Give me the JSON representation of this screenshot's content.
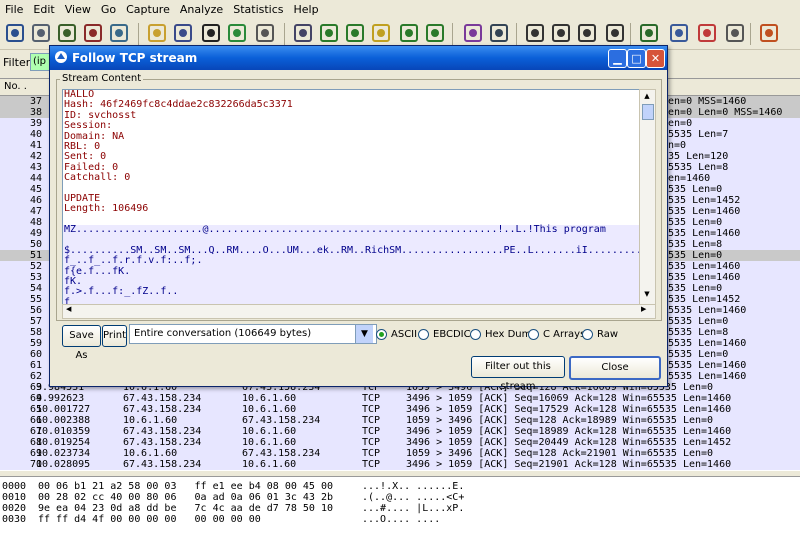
{
  "menu": [
    "File",
    "Edit",
    "View",
    "Go",
    "Capture",
    "Analyze",
    "Statistics",
    "Help"
  ],
  "toolbar_icons": [
    "interface-list-icon",
    "capture-options-icon",
    "start-capture-icon",
    "stop-capture-icon",
    "restart-capture-icon",
    "open-file-icon",
    "save-file-icon",
    "close-file-icon",
    "reload-icon",
    "print-icon",
    "find-packet-icon",
    "go-back-icon",
    "go-forward-icon",
    "go-to-packet-icon",
    "go-first-icon",
    "go-last-icon",
    "colorize-icon",
    "auto-scroll-icon",
    "zoom-in-icon",
    "zoom-out-icon",
    "zoom-normal-icon",
    "resize-columns-icon",
    "capture-filters-icon",
    "display-filters-icon",
    "coloring-rules-icon",
    "preferences-icon",
    "help-icon"
  ],
  "filter": {
    "label": "Filter:",
    "value": "(ip"
  },
  "packet_list": {
    "header": {
      "no": "No. ."
    },
    "rows": [
      {
        "no": "37",
        "time": "",
        "src": "",
        "dst": "",
        "proto": "",
        "info": "Len=0 MSS=1460",
        "sel": true
      },
      {
        "no": "38",
        "time": "",
        "src": "",
        "dst": "",
        "proto": "",
        "info": "Len=0 Len=0 MSS=1460",
        "sel": true
      },
      {
        "no": "39",
        "time": "",
        "src": "",
        "dst": "",
        "proto": "",
        "info": "Len=0"
      },
      {
        "no": "40",
        "time": "",
        "src": "",
        "dst": "",
        "proto": "",
        "info": "65535 Len=7"
      },
      {
        "no": "41",
        "time": "",
        "src": "",
        "dst": "",
        "proto": "",
        "info": "en=0"
      },
      {
        "no": "42",
        "time": "",
        "src": "",
        "dst": "",
        "proto": "",
        "info": "535 Len=120"
      },
      {
        "no": "43",
        "time": "",
        "src": "",
        "dst": "",
        "proto": "",
        "info": "65535 Len=8"
      },
      {
        "no": "44",
        "time": "",
        "src": "",
        "dst": "",
        "proto": "",
        "info": "Len=1460"
      },
      {
        "no": "45",
        "time": "",
        "src": "",
        "dst": "",
        "proto": "",
        "info": "5535 Len=0"
      },
      {
        "no": "46",
        "time": "",
        "src": "",
        "dst": "",
        "proto": "",
        "info": "5535 Len=1452"
      },
      {
        "no": "47",
        "time": "",
        "src": "",
        "dst": "",
        "proto": "",
        "info": "5535 Len=1460"
      },
      {
        "no": "48",
        "time": "",
        "src": "",
        "dst": "",
        "proto": "",
        "info": "5535 Len=0"
      },
      {
        "no": "49",
        "time": "",
        "src": "",
        "dst": "",
        "proto": "",
        "info": "5535 Len=1460"
      },
      {
        "no": "50",
        "time": "",
        "src": "",
        "dst": "",
        "proto": "",
        "info": "5535 Len=8"
      },
      {
        "no": "51",
        "time": "",
        "src": "",
        "dst": "",
        "proto": "",
        "info": "5535 Len=0",
        "sel": true
      },
      {
        "no": "52",
        "time": "",
        "src": "",
        "dst": "",
        "proto": "",
        "info": "5535 Len=1460"
      },
      {
        "no": "53",
        "time": "",
        "src": "",
        "dst": "",
        "proto": "",
        "info": "5535 Len=1460"
      },
      {
        "no": "54",
        "time": "",
        "src": "",
        "dst": "",
        "proto": "",
        "info": "5535 Len=0"
      },
      {
        "no": "55",
        "time": "",
        "src": "",
        "dst": "",
        "proto": "",
        "info": "5535 Len=1452"
      },
      {
        "no": "56",
        "time": "",
        "src": "",
        "dst": "",
        "proto": "",
        "info": "65535 Len=1460"
      },
      {
        "no": "57",
        "time": "",
        "src": "",
        "dst": "",
        "proto": "",
        "info": "65535 Len=0"
      },
      {
        "no": "58",
        "time": "",
        "src": "",
        "dst": "",
        "proto": "",
        "info": "65535 Len=8"
      },
      {
        "no": "59",
        "time": "",
        "src": "",
        "dst": "",
        "proto": "",
        "info": "65535 Len=1460"
      },
      {
        "no": "60",
        "time": "",
        "src": "",
        "dst": "",
        "proto": "",
        "info": "65535 Len=0"
      },
      {
        "no": "61",
        "time": "",
        "src": "",
        "dst": "",
        "proto": "",
        "info": "65535 Len=1460"
      },
      {
        "no": "62",
        "time": "",
        "src": "",
        "dst": "",
        "proto": "",
        "info": "65535 Len=1460"
      },
      {
        "no": "63",
        "time": "9.984531",
        "src": "10.6.1.60",
        "dst": "67.43.158.234",
        "proto": "TCP",
        "info": "1059 > 3496 [ACK] Seq=128 Ack=16069 Win=65535 Len=0"
      },
      {
        "no": "64",
        "time": "9.992623",
        "src": "67.43.158.234",
        "dst": "10.6.1.60",
        "proto": "TCP",
        "info": "3496 > 1059 [ACK] Seq=16069 Ack=128 Win=65535 Len=1460"
      },
      {
        "no": "65",
        "time": "10.001727",
        "src": "67.43.158.234",
        "dst": "10.6.1.60",
        "proto": "TCP",
        "info": "3496 > 1059 [ACK] Seq=17529 Ack=128 Win=65535 Len=1460"
      },
      {
        "no": "66",
        "time": "10.002388",
        "src": "10.6.1.60",
        "dst": "67.43.158.234",
        "proto": "TCP",
        "info": "1059 > 3496 [ACK] Seq=128 Ack=18989 Win=65535 Len=0"
      },
      {
        "no": "67",
        "time": "10.010359",
        "src": "67.43.158.234",
        "dst": "10.6.1.60",
        "proto": "TCP",
        "info": "3496 > 1059 [ACK] Seq=18989 Ack=128 Win=65535 Len=1460"
      },
      {
        "no": "68",
        "time": "10.019254",
        "src": "67.43.158.234",
        "dst": "10.6.1.60",
        "proto": "TCP",
        "info": "3496 > 1059 [ACK] Seq=20449 Ack=128 Win=65535 Len=1452"
      },
      {
        "no": "69",
        "time": "10.023734",
        "src": "10.6.1.60",
        "dst": "67.43.158.234",
        "proto": "TCP",
        "info": "1059 > 3496 [ACK] Seq=128 Ack=21901 Win=65535 Len=0"
      },
      {
        "no": "70",
        "time": "10.028095",
        "src": "67.43.158.234",
        "dst": "10.6.1.60",
        "proto": "TCP",
        "info": "3496 > 1059 [ACK] Seq=21901 Ack=128 Win=65535 Len=1460"
      }
    ]
  },
  "bytes_pane": [
    {
      "offset": "0000",
      "hex": "00 06 b1 21 a2 58 00 03   ff e1 ee b4 08 00 45 00",
      "ascii": "...!.X.. ......E."
    },
    {
      "offset": "0010",
      "hex": "00 28 02 cc 40 00 80 06   0a ad 0a 06 01 3c 43 2b",
      "ascii": ".(..@... .....<C+"
    },
    {
      "offset": "0020",
      "hex": "9e ea 04 23 0d a8 dd be   7c 4c aa de d7 78 50 10",
      "ascii": "...#.... |L...xP."
    },
    {
      "offset": "0030",
      "hex": "ff ff d4 4f 00 00 00 00   00 00 00 00",
      "ascii": "...O.... ...."
    }
  ],
  "dialog": {
    "title": "Follow TCP stream",
    "stream_label": "Stream Content",
    "client_lines": [
      "HALLO",
      "Hash: 46f2469fc8c4ddae2c832266da5c3371",
      "ID: svchosst",
      "Session:",
      "Domain: NA",
      "RBL: 0",
      "Sent: 0",
      "Failed: 0",
      "Catchall: 0",
      "",
      "UPDATE",
      "Length: 106496",
      ""
    ],
    "server_lines": [
      "MZ.....................@................................................!..L.!This program",
      "",
      "$..........SM..SM..SM...Q..RM....O...UM...ek..RM..RichSM.................PE..L.......iI.........",
      "f_..f_..f.r.f.v.f:..f;.",
      "f{e.f...fK.",
      "fK.",
      "f.>.f...f:_.fZ..f..",
      "f"
    ],
    "save_as": "Save As",
    "print": "Print",
    "conversation": "Entire conversation (106649 bytes)",
    "radios": [
      {
        "label": "ASCII",
        "on": true
      },
      {
        "label": "EBCDIC",
        "on": false
      },
      {
        "label": "Hex Dump",
        "on": false
      },
      {
        "label": "C Arrays",
        "on": false
      },
      {
        "label": "Raw",
        "on": false
      }
    ],
    "filter_out": "Filter out this stream",
    "close": "Close"
  }
}
